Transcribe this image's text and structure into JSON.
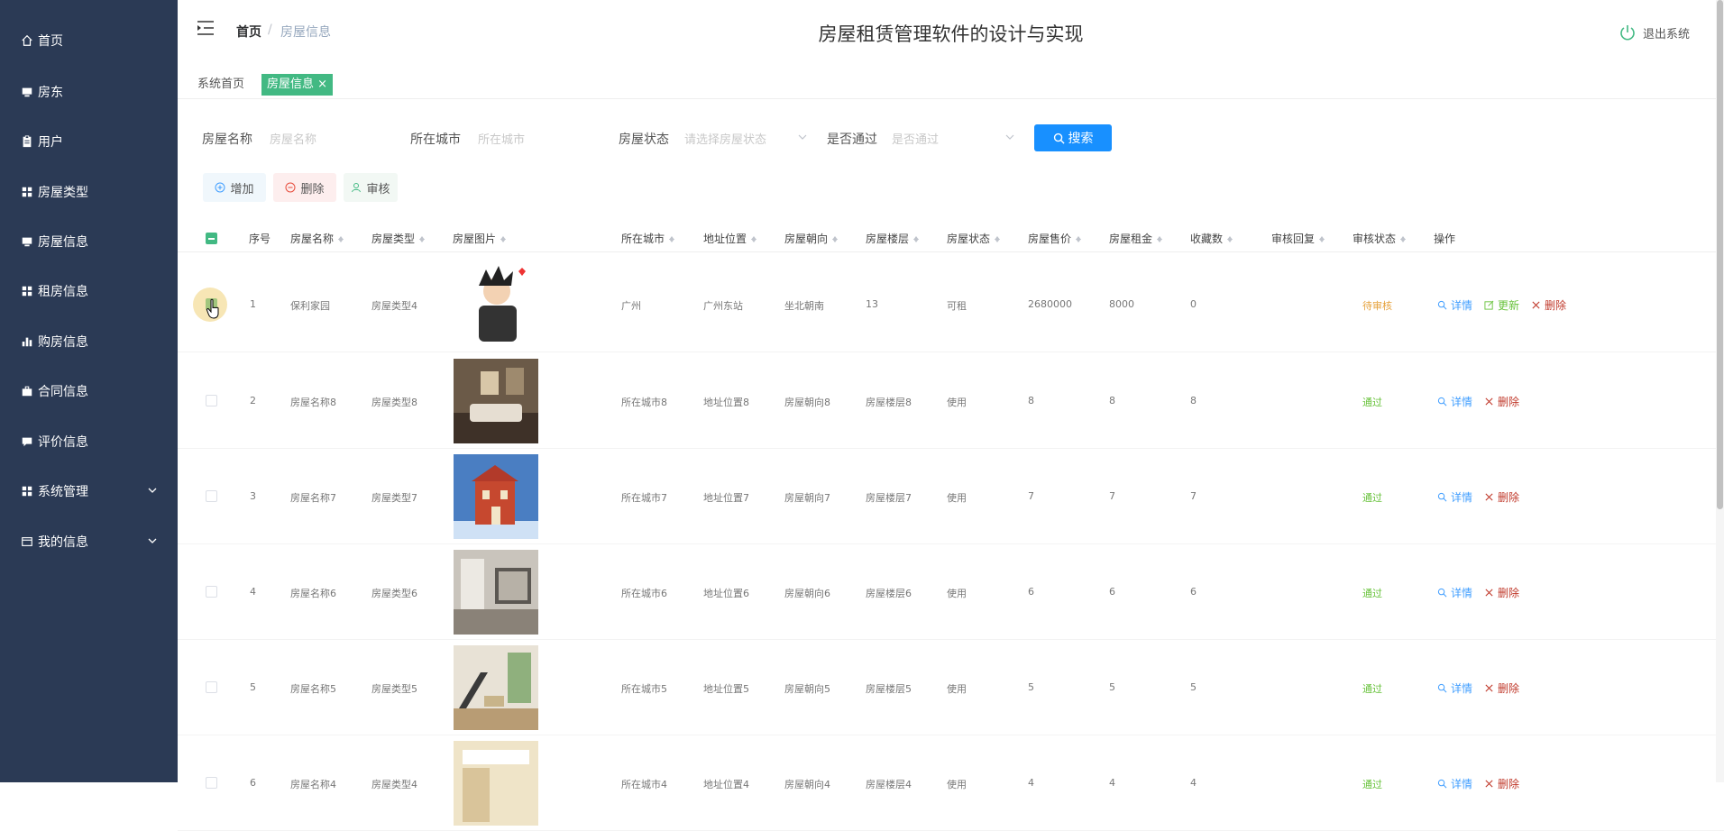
{
  "app_title": "房屋租赁管理软件的设计与实现",
  "logout_label": "退出系统",
  "breadcrumb": {
    "home": "首页",
    "sep": "/",
    "current": "房屋信息"
  },
  "tabs": [
    {
      "label": "系统首页"
    },
    {
      "label": "房屋信息 ×"
    }
  ],
  "sidebar": {
    "items": [
      {
        "label": "首页",
        "icon": "home-icon"
      },
      {
        "label": "房东",
        "icon": "monitor-icon"
      },
      {
        "label": "用户",
        "icon": "clipboard-icon"
      },
      {
        "label": "房屋类型",
        "icon": "grid-icon"
      },
      {
        "label": "房屋信息",
        "icon": "monitor-icon"
      },
      {
        "label": "租房信息",
        "icon": "grid-icon"
      },
      {
        "label": "购房信息",
        "icon": "bar-chart-icon"
      },
      {
        "label": "合同信息",
        "icon": "briefcase-icon"
      },
      {
        "label": "评价信息",
        "icon": "comment-icon"
      },
      {
        "label": "系统管理",
        "icon": "grid-icon"
      },
      {
        "label": "我的信息",
        "icon": "wallet-icon"
      }
    ]
  },
  "search": {
    "name_label": "房屋名称",
    "name_placeholder": "房屋名称",
    "city_label": "所在城市",
    "city_placeholder": "所在城市",
    "state_label": "房屋状态",
    "state_placeholder": "请选择房屋状态",
    "pass_label": "是否通过",
    "pass_placeholder": "是否通过",
    "button": "搜索"
  },
  "actions": {
    "add": "增加",
    "delete": "删除",
    "audit": "审核"
  },
  "table": {
    "headers": {
      "index": "序号",
      "name": "房屋名称",
      "type": "房屋类型",
      "image": "房屋图片",
      "city": "所在城市",
      "address": "地址位置",
      "orientation": "房屋朝向",
      "floor": "房屋楼层",
      "state": "房屋状态",
      "price": "房屋售价",
      "rent": "房屋租金",
      "favorites": "收藏数",
      "reply": "审核回复",
      "audit": "审核状态",
      "ops": "操作"
    },
    "rows": [
      {
        "index": "1",
        "name": "保利家园",
        "type": "房屋类型4",
        "city": "广州",
        "address": "广州东站",
        "orientation": "坐北朝南",
        "floor": "13",
        "state": "可租",
        "price": "2680000",
        "rent": "8000",
        "favorites": "0",
        "reply": "",
        "audit": "待审核",
        "audit_kind": "pending",
        "has_update": true,
        "checked": true
      },
      {
        "index": "2",
        "name": "房屋名称8",
        "type": "房屋类型8",
        "city": "所在城市8",
        "address": "地址位置8",
        "orientation": "房屋朝向8",
        "floor": "房屋楼层8",
        "state": "使用",
        "price": "8",
        "rent": "8",
        "favorites": "8",
        "reply": "",
        "audit": "通过",
        "audit_kind": "pass",
        "has_update": false,
        "checked": false
      },
      {
        "index": "3",
        "name": "房屋名称7",
        "type": "房屋类型7",
        "city": "所在城市7",
        "address": "地址位置7",
        "orientation": "房屋朝向7",
        "floor": "房屋楼层7",
        "state": "使用",
        "price": "7",
        "rent": "7",
        "favorites": "7",
        "reply": "",
        "audit": "通过",
        "audit_kind": "pass",
        "has_update": false,
        "checked": false
      },
      {
        "index": "4",
        "name": "房屋名称6",
        "type": "房屋类型6",
        "city": "所在城市6",
        "address": "地址位置6",
        "orientation": "房屋朝向6",
        "floor": "房屋楼层6",
        "state": "使用",
        "price": "6",
        "rent": "6",
        "favorites": "6",
        "reply": "",
        "audit": "通过",
        "audit_kind": "pass",
        "has_update": false,
        "checked": false
      },
      {
        "index": "5",
        "name": "房屋名称5",
        "type": "房屋类型5",
        "city": "所在城市5",
        "address": "地址位置5",
        "orientation": "房屋朝向5",
        "floor": "房屋楼层5",
        "state": "使用",
        "price": "5",
        "rent": "5",
        "favorites": "5",
        "reply": "",
        "audit": "通过",
        "audit_kind": "pass",
        "has_update": false,
        "checked": false
      },
      {
        "index": "6",
        "name": "房屋名称4",
        "type": "房屋类型4",
        "city": "所在城市4",
        "address": "地址位置4",
        "orientation": "房屋朝向4",
        "floor": "房屋楼层4",
        "state": "使用",
        "price": "4",
        "rent": "4",
        "favorites": "4",
        "reply": "",
        "audit": "通过",
        "audit_kind": "pass",
        "has_update": false,
        "checked": false
      }
    ],
    "op_labels": {
      "detail": "详情",
      "update": "更新",
      "delete": "删除"
    }
  },
  "colors": {
    "sidebar_bg": "#2b3a55",
    "accent_green": "#42b983",
    "primary_blue": "#1890ff",
    "pending": "#e6a23c",
    "pass": "#67c23a"
  }
}
